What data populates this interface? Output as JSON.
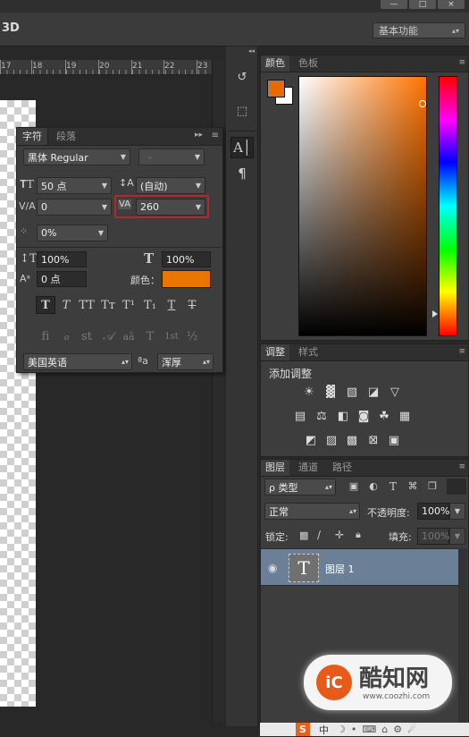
{
  "optbar": {
    "label_3d": "3D",
    "workspace": "基本功能"
  },
  "window_buttons": [
    "—",
    "□",
    "×"
  ],
  "ruler": {
    "numbers": [
      "17",
      "18",
      "19",
      "20",
      "21",
      "22",
      "23"
    ]
  },
  "character_panel": {
    "tabs": [
      "字符",
      "段落"
    ],
    "font_family": "黑体 Regular",
    "font_style": "-",
    "font_size": "50 点",
    "leading": "(自动)",
    "kerning": "0",
    "tracking": "260",
    "tsume": "0%",
    "vertical_scale": "100%",
    "horizontal_scale": "100%",
    "baseline_shift": "0 点",
    "color_label": "颜色：",
    "color": "#ea7500",
    "style_buttons": [
      "T",
      "T",
      "TT",
      "Tт",
      "T¹",
      "T₁",
      "T",
      "T"
    ],
    "opentype_buttons": [
      "fi",
      "ℴ",
      "st",
      "𝒜",
      "aā",
      "T",
      "1st",
      "½"
    ],
    "language": "美国英语",
    "aa_icon": "ªa",
    "antialias": "浑厚"
  },
  "tool_icons": [
    "history-icon",
    "cube-icon",
    "character-icon",
    "paragraph-icon"
  ],
  "color_panel": {
    "tabs": [
      "颜色",
      "色板"
    ],
    "foreground": "#e86a00",
    "background": "#ffffff",
    "hue": "#ff7300"
  },
  "adjustments_panel": {
    "tabs": [
      "调整",
      "样式"
    ],
    "heading": "添加调整"
  },
  "layers_panel": {
    "tabs": [
      "图层",
      "通道",
      "路径"
    ],
    "filter_label": "ρ 类型",
    "blend_mode": "正常",
    "opacity_label": "不透明度:",
    "opacity": "100%",
    "lock_label": "锁定:",
    "fill_label": "填充:",
    "fill": "100%",
    "layer_name": "图层 1",
    "layer_thumb": "T",
    "selected_color": "#6b7f97"
  },
  "watermark": {
    "title": "酷知网",
    "url": "www.coozhi.com"
  },
  "taskbar": [
    "S",
    "中"
  ]
}
